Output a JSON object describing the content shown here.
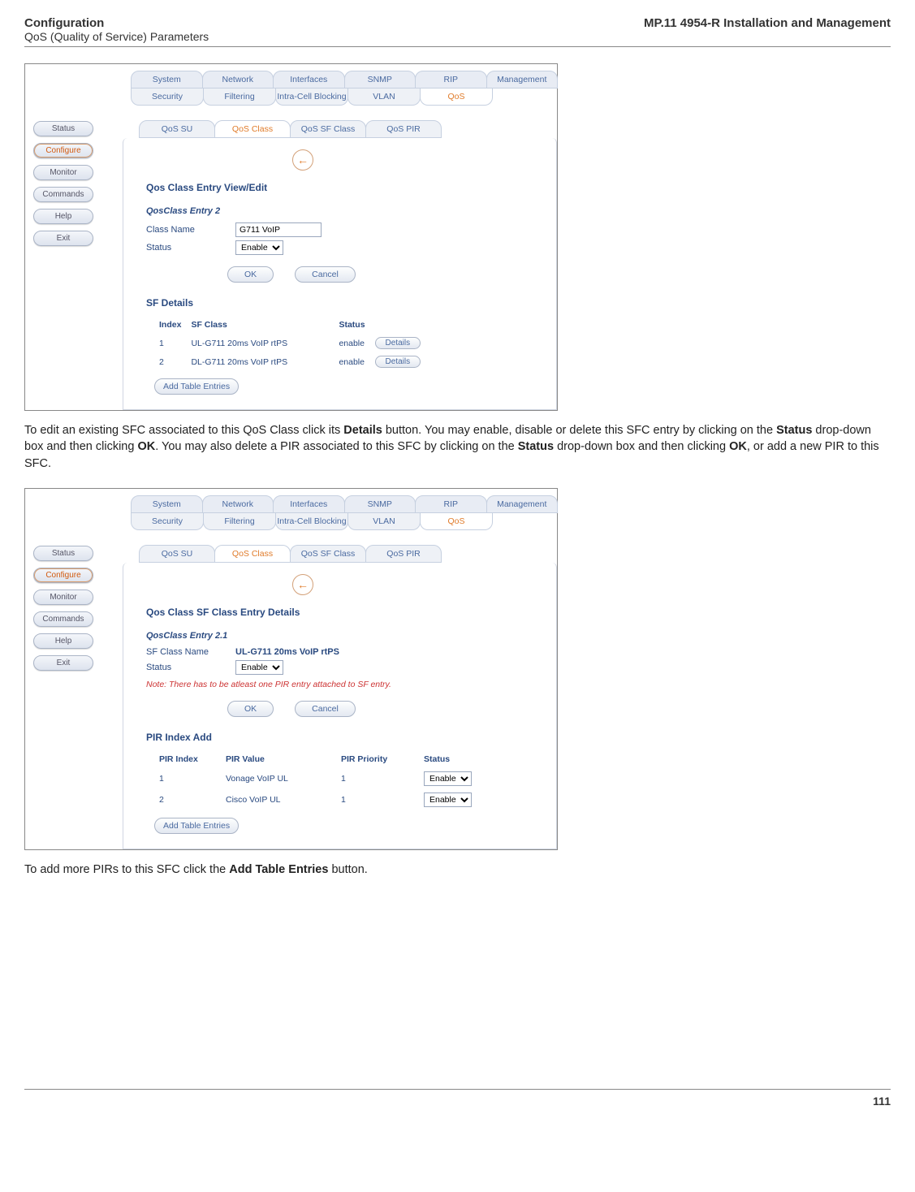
{
  "header": {
    "left_title": "Configuration",
    "left_subtitle": "QoS (Quality of Service) Parameters",
    "right_title": "MP.11 4954-R Installation and Management"
  },
  "screenshot1": {
    "main_tabs": [
      "System",
      "Network",
      "Interfaces",
      "SNMP",
      "RIP",
      "Management"
    ],
    "sub_tabs": [
      "Security",
      "Filtering",
      "Intra-Cell Blocking",
      "VLAN",
      "QoS"
    ],
    "active_sub_tab": "QoS",
    "side_nav": [
      "Status",
      "Configure",
      "Monitor",
      "Commands",
      "Help",
      "Exit"
    ],
    "active_side": "Configure",
    "inner_tabs": [
      "QoS SU",
      "QoS Class",
      "QoS SF Class",
      "QoS PIR"
    ],
    "active_inner": "QoS Class",
    "panel_title": "Qos Class Entry View/Edit",
    "entry_heading": "QosClass Entry 2",
    "class_name_label": "Class Name",
    "class_name_value": "G711 VoIP",
    "status_label": "Status",
    "status_value": "Enable",
    "ok_label": "OK",
    "cancel_label": "Cancel",
    "sf_title": "SF Details",
    "sf_headers": {
      "index": "Index",
      "sfclass": "SF Class",
      "status": "Status"
    },
    "sf_rows": [
      {
        "index": "1",
        "sfclass": "UL-G711 20ms VoIP rtPS",
        "status": "enable",
        "btn": "Details"
      },
      {
        "index": "2",
        "sfclass": "DL-G711 20ms VoIP rtPS",
        "status": "enable",
        "btn": "Details"
      }
    ],
    "add_label": "Add Table Entries"
  },
  "para1_prefix": "To edit an existing SFC associated to this QoS Class click its ",
  "para1_b1": "Details",
  "para1_mid1": " button. You may enable, disable or delete this SFC entry by clicking on the ",
  "para1_b2": "Status",
  "para1_mid2": " drop-down box and then clicking ",
  "para1_b3": "OK",
  "para1_mid3": ". You may also delete a PIR associated to this SFC by clicking on the ",
  "para1_b4": "Status",
  "para1_mid4": " drop-down box and then clicking ",
  "para1_b5": "OK",
  "para1_suffix": ", or add a new PIR to this SFC.",
  "screenshot2": {
    "main_tabs": [
      "System",
      "Network",
      "Interfaces",
      "SNMP",
      "RIP",
      "Management"
    ],
    "sub_tabs": [
      "Security",
      "Filtering",
      "Intra-Cell Blocking",
      "VLAN",
      "QoS"
    ],
    "active_sub_tab": "QoS",
    "side_nav": [
      "Status",
      "Configure",
      "Monitor",
      "Commands",
      "Help",
      "Exit"
    ],
    "active_side": "Configure",
    "inner_tabs": [
      "QoS SU",
      "QoS Class",
      "QoS SF Class",
      "QoS PIR"
    ],
    "active_inner": "QoS Class",
    "panel_title": "Qos Class SF Class Entry Details",
    "entry_heading": "QosClass Entry 2.1",
    "sf_name_label": "SF Class Name",
    "sf_name_value": "UL-G711 20ms VoIP rtPS",
    "status_label": "Status",
    "status_value": "Enable",
    "note": "Note: There has to be atleast one PIR entry attached to SF entry.",
    "ok_label": "OK",
    "cancel_label": "Cancel",
    "pir_title": "PIR Index Add",
    "pir_headers": {
      "index": "PIR Index",
      "value": "PIR Value",
      "priority": "PIR Priority",
      "status": "Status"
    },
    "pir_rows": [
      {
        "index": "1",
        "value": "Vonage VoIP UL",
        "priority": "1",
        "status": "Enable"
      },
      {
        "index": "2",
        "value": "Cisco VoIP UL",
        "priority": "1",
        "status": "Enable"
      }
    ],
    "add_label": "Add Table Entries"
  },
  "para2_prefix": "To add more PIRs to this SFC click the ",
  "para2_b1": "Add Table Entries",
  "para2_suffix": " button.",
  "page_number": "111"
}
